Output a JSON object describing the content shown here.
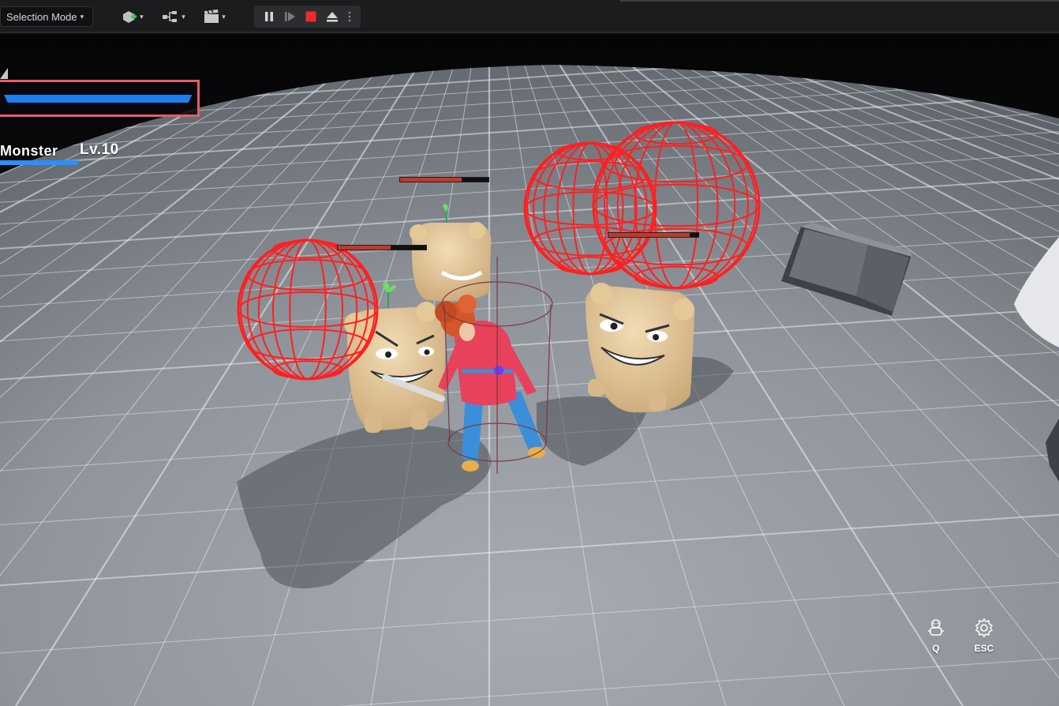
{
  "toolbar": {
    "selection_mode_label": "Selection Mode",
    "icons": [
      "add-actor-icon",
      "blueprint-icon",
      "cinematics-icon"
    ],
    "play_controls": [
      "pause-icon",
      "step-frame-icon",
      "stop-icon",
      "eject-icon",
      "more-options-icon"
    ]
  },
  "hud": {
    "player_health_fraction": 0.95,
    "monster_name": "Monster",
    "monster_level": "Lv.10",
    "accent_color": "#e85b6a",
    "bar_color": "#1e7df0"
  },
  "enemies": [
    {
      "name": "enemy-back",
      "health_fraction": 0.7
    },
    {
      "name": "enemy-left",
      "health_fraction": 0.6
    },
    {
      "name": "enemy-right",
      "health_fraction": 0.9
    }
  ],
  "hotkeys": [
    {
      "icon": "character-icon",
      "label": "Q"
    },
    {
      "icon": "settings-gear-icon",
      "label": "ESC"
    }
  ],
  "colors": {
    "ground": "#8e939b",
    "debug_sphere": "#ff2020",
    "enemy_body": "#e2c596",
    "player_jacket": "#e8415c",
    "player_hair": "#d4562a"
  }
}
